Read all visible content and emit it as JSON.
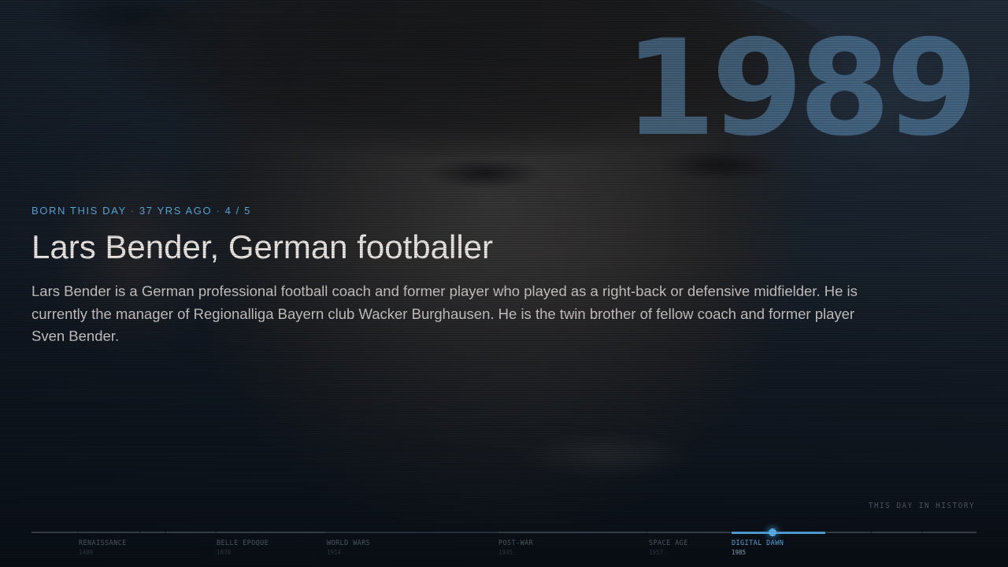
{
  "year": "1989",
  "kicker": {
    "category": "BORN THIS DAY",
    "age": "37 YRS AGO",
    "position": "4 / 5"
  },
  "headline": "Lars Bender, German footballer",
  "summary": "Lars Bender is a German professional football coach and former player who played as a right-back or defensive midfielder. He is currently the manager of Regionalliga Bayern club Wacker Burghausen. He is the twin brother of fellow coach and former player Sven Bender.",
  "tagline": "THIS DAY IN HISTORY",
  "timeline": {
    "eras": [
      {
        "name": "RENAISSANCE",
        "year": "1400"
      },
      {
        "name": "BELLE EPOQUE",
        "year": "1870"
      },
      {
        "name": "WORLD WARS",
        "year": "1914"
      },
      {
        "name": "POST-WAR",
        "year": "1945"
      },
      {
        "name": "SPACE AGE",
        "year": "1957"
      },
      {
        "name": "DIGITAL DAWN",
        "year": "1985"
      }
    ],
    "active_era": "DIGITAL DAWN"
  },
  "colors": {
    "accent": "#5ca9dc",
    "year": "#6094be"
  }
}
